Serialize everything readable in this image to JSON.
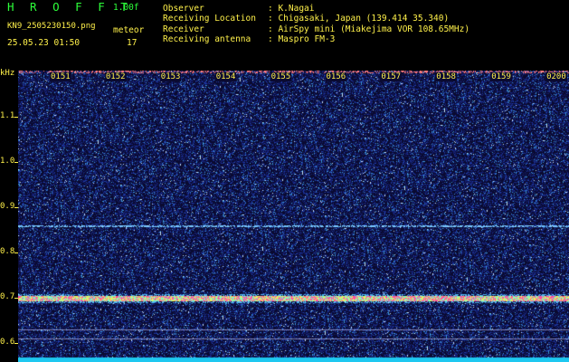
{
  "app": {
    "brand": "H R O F F T",
    "version": "1.00f",
    "filename": "KN9_2505230150.png",
    "mode": "meteor",
    "datetime": "25.05.23 01:50",
    "count": "17"
  },
  "info": {
    "observer_label": "Observer",
    "observer_value": ": K.Nagai",
    "location_label": "Receiving Location",
    "location_value": ": Chigasaki, Japan (139.414 35.340)",
    "receiver_label": "Receiver",
    "receiver_value": ": AirSpy mini (Miakejima VOR 108.65MHz)",
    "antenna_label": "Receiving antenna",
    "antenna_value": ": Maspro FM-3"
  },
  "axis": {
    "unit": "kHz",
    "labels": [
      {
        "text": "1.1",
        "khz": 1.1
      },
      {
        "text": "1.0",
        "khz": 1.0
      },
      {
        "text": "0.9",
        "khz": 0.9
      },
      {
        "text": "0.8",
        "khz": 0.8
      },
      {
        "text": "0.7",
        "khz": 0.7
      },
      {
        "text": "0.6",
        "khz": 0.6
      }
    ],
    "time_labels": [
      "0151",
      "0152",
      "0153",
      "0154",
      "0155",
      "0156",
      "0157",
      "0158",
      "0159",
      "0200"
    ]
  },
  "colors": {
    "text_green": "#2dff3a",
    "text_yellow": "#fff14a",
    "background": "#000000",
    "waterfall_base": "#0a0a30"
  }
}
